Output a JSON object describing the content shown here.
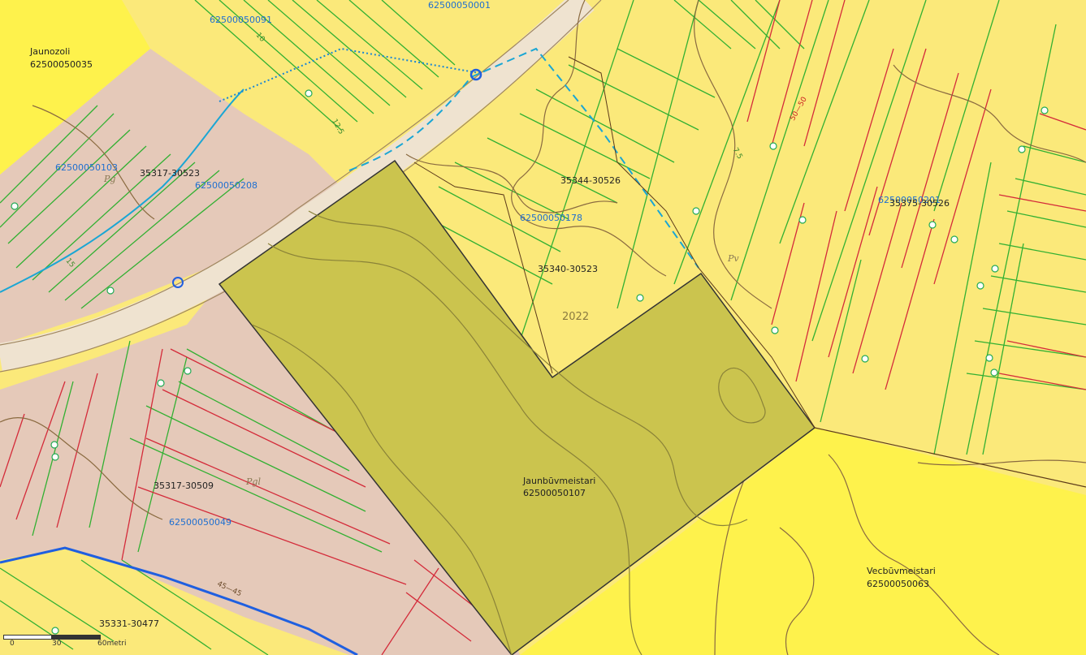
{
  "map": {
    "colors": {
      "background": "#fbe97a",
      "pink_zone": "#e5c9b9",
      "bright_yellow": "#fef24c",
      "selected_parcel": "#cbc44e",
      "green_line": "#32b032",
      "red_line": "#d42b3a",
      "contour": "#8a6a40",
      "road": "#efe3d0",
      "water_blue": "#1f5fe0",
      "cyan": "#1aa6d4"
    },
    "parcels": [
      {
        "name": "Jaunozoli",
        "code": "62500050035"
      },
      {
        "name": "Jaunbūvmeistari",
        "code": "62500050107"
      },
      {
        "name": "Vecbūvmeistari",
        "code": "62500050063"
      }
    ],
    "cadastre_blue": [
      "62500050091",
      "62500050001",
      "62500050103",
      "62500050208",
      "62500050049",
      "62500050178",
      "62500050201"
    ],
    "compartments": [
      "35317-30523",
      "35344-30526",
      "35340-30523",
      "35375-30526",
      "35317-30509",
      "35331-30477"
    ],
    "land_use": [
      "Pg",
      "Pv",
      "Pgl"
    ],
    "year": "2022",
    "contour_labels": [
      "10",
      "12.5",
      "7.5",
      "15",
      "50—50",
      "45—45"
    ],
    "scale": {
      "ticks": [
        "0",
        "30",
        "60metri"
      ]
    }
  }
}
